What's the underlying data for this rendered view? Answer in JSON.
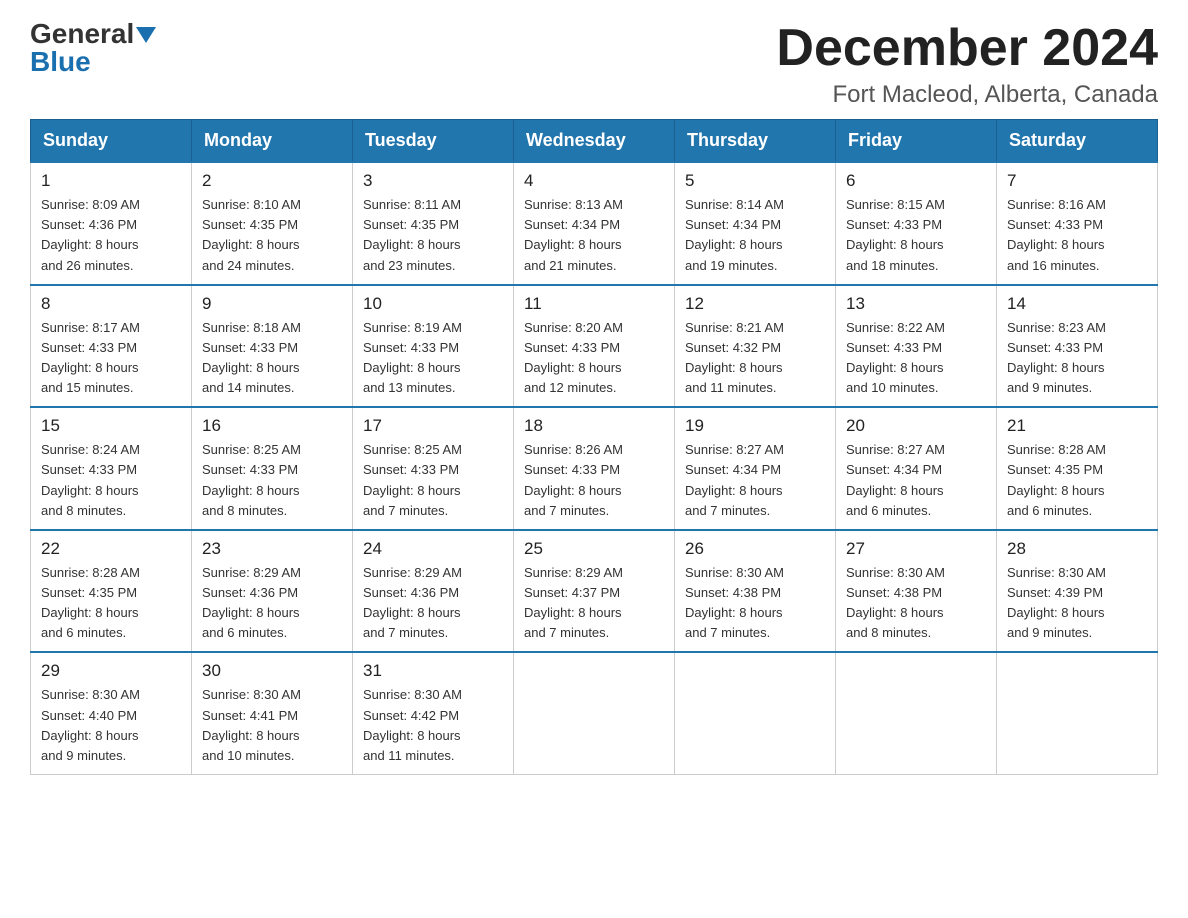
{
  "logo": {
    "general": "General",
    "blue": "Blue"
  },
  "title": {
    "month": "December 2024",
    "location": "Fort Macleod, Alberta, Canada"
  },
  "headers": [
    "Sunday",
    "Monday",
    "Tuesday",
    "Wednesday",
    "Thursday",
    "Friday",
    "Saturday"
  ],
  "weeks": [
    [
      {
        "day": "1",
        "sunrise": "8:09 AM",
        "sunset": "4:36 PM",
        "daylight": "8 hours and 26 minutes."
      },
      {
        "day": "2",
        "sunrise": "8:10 AM",
        "sunset": "4:35 PM",
        "daylight": "8 hours and 24 minutes."
      },
      {
        "day": "3",
        "sunrise": "8:11 AM",
        "sunset": "4:35 PM",
        "daylight": "8 hours and 23 minutes."
      },
      {
        "day": "4",
        "sunrise": "8:13 AM",
        "sunset": "4:34 PM",
        "daylight": "8 hours and 21 minutes."
      },
      {
        "day": "5",
        "sunrise": "8:14 AM",
        "sunset": "4:34 PM",
        "daylight": "8 hours and 19 minutes."
      },
      {
        "day": "6",
        "sunrise": "8:15 AM",
        "sunset": "4:33 PM",
        "daylight": "8 hours and 18 minutes."
      },
      {
        "day": "7",
        "sunrise": "8:16 AM",
        "sunset": "4:33 PM",
        "daylight": "8 hours and 16 minutes."
      }
    ],
    [
      {
        "day": "8",
        "sunrise": "8:17 AM",
        "sunset": "4:33 PM",
        "daylight": "8 hours and 15 minutes."
      },
      {
        "day": "9",
        "sunrise": "8:18 AM",
        "sunset": "4:33 PM",
        "daylight": "8 hours and 14 minutes."
      },
      {
        "day": "10",
        "sunrise": "8:19 AM",
        "sunset": "4:33 PM",
        "daylight": "8 hours and 13 minutes."
      },
      {
        "day": "11",
        "sunrise": "8:20 AM",
        "sunset": "4:33 PM",
        "daylight": "8 hours and 12 minutes."
      },
      {
        "day": "12",
        "sunrise": "8:21 AM",
        "sunset": "4:32 PM",
        "daylight": "8 hours and 11 minutes."
      },
      {
        "day": "13",
        "sunrise": "8:22 AM",
        "sunset": "4:33 PM",
        "daylight": "8 hours and 10 minutes."
      },
      {
        "day": "14",
        "sunrise": "8:23 AM",
        "sunset": "4:33 PM",
        "daylight": "8 hours and 9 minutes."
      }
    ],
    [
      {
        "day": "15",
        "sunrise": "8:24 AM",
        "sunset": "4:33 PM",
        "daylight": "8 hours and 8 minutes."
      },
      {
        "day": "16",
        "sunrise": "8:25 AM",
        "sunset": "4:33 PM",
        "daylight": "8 hours and 8 minutes."
      },
      {
        "day": "17",
        "sunrise": "8:25 AM",
        "sunset": "4:33 PM",
        "daylight": "8 hours and 7 minutes."
      },
      {
        "day": "18",
        "sunrise": "8:26 AM",
        "sunset": "4:33 PM",
        "daylight": "8 hours and 7 minutes."
      },
      {
        "day": "19",
        "sunrise": "8:27 AM",
        "sunset": "4:34 PM",
        "daylight": "8 hours and 7 minutes."
      },
      {
        "day": "20",
        "sunrise": "8:27 AM",
        "sunset": "4:34 PM",
        "daylight": "8 hours and 6 minutes."
      },
      {
        "day": "21",
        "sunrise": "8:28 AM",
        "sunset": "4:35 PM",
        "daylight": "8 hours and 6 minutes."
      }
    ],
    [
      {
        "day": "22",
        "sunrise": "8:28 AM",
        "sunset": "4:35 PM",
        "daylight": "8 hours and 6 minutes."
      },
      {
        "day": "23",
        "sunrise": "8:29 AM",
        "sunset": "4:36 PM",
        "daylight": "8 hours and 6 minutes."
      },
      {
        "day": "24",
        "sunrise": "8:29 AM",
        "sunset": "4:36 PM",
        "daylight": "8 hours and 7 minutes."
      },
      {
        "day": "25",
        "sunrise": "8:29 AM",
        "sunset": "4:37 PM",
        "daylight": "8 hours and 7 minutes."
      },
      {
        "day": "26",
        "sunrise": "8:30 AM",
        "sunset": "4:38 PM",
        "daylight": "8 hours and 7 minutes."
      },
      {
        "day": "27",
        "sunrise": "8:30 AM",
        "sunset": "4:38 PM",
        "daylight": "8 hours and 8 minutes."
      },
      {
        "day": "28",
        "sunrise": "8:30 AM",
        "sunset": "4:39 PM",
        "daylight": "8 hours and 9 minutes."
      }
    ],
    [
      {
        "day": "29",
        "sunrise": "8:30 AM",
        "sunset": "4:40 PM",
        "daylight": "8 hours and 9 minutes."
      },
      {
        "day": "30",
        "sunrise": "8:30 AM",
        "sunset": "4:41 PM",
        "daylight": "8 hours and 10 minutes."
      },
      {
        "day": "31",
        "sunrise": "8:30 AM",
        "sunset": "4:42 PM",
        "daylight": "8 hours and 11 minutes."
      },
      null,
      null,
      null,
      null
    ]
  ],
  "labels": {
    "sunrise": "Sunrise:",
    "sunset": "Sunset:",
    "daylight": "Daylight:"
  }
}
